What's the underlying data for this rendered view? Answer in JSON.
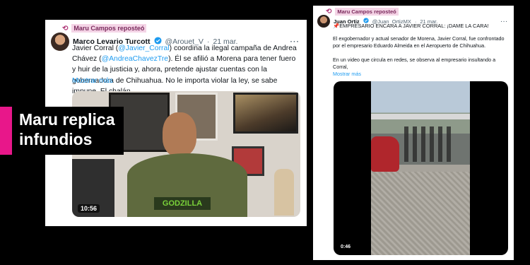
{
  "colors": {
    "accent_magenta": "#e8178a",
    "link_blue": "#1d9bf0",
    "repost_highlight": "#f4d4e6"
  },
  "left_tweet": {
    "repost_label": "Maru Campos reposteó",
    "author_name": "Marco Levario Turcott",
    "handle": "@Arouet_V",
    "date": "21 mar.",
    "text_segments": [
      {
        "text": "Javier Corral (",
        "type": "text"
      },
      {
        "text": "@Javier_Corral",
        "type": "mention"
      },
      {
        "text": ") coordina la ilegal campaña de Andrea Chávez (",
        "type": "text"
      },
      {
        "text": "@AndreaChavezTre",
        "type": "mention"
      },
      {
        "text": "). Él se afilió a Morena para tener fuero y huir de la justicia y, ahora, pretende ajustar cuentas con la gobernadora de Chihuahua. No le importa violar la ley, se sabe impune. El chalán",
        "type": "text"
      }
    ],
    "show_more": "Mostrar más",
    "video_duration": "10:56",
    "shirt_print": "GODZILLA"
  },
  "right_tweet": {
    "repost_label": "Maru Campos reposteó",
    "author_name": "Juan Ortiz",
    "handle": "@Juan_OrtizMX",
    "date": "21 mar.",
    "headline": "📌EMPRESARIO ENCARA A JAVIER CORRAL: ¡DAME LA CARA!",
    "paragraph_1": "El exgobernador y actual senador de Morena, Javier Corral, fue confrontado por el empresario Eduardo Almeida en el Aeropuerto de Chihuahua.",
    "paragraph_2": "En un video que circula en redes, se observa al empresario insultando a Corral,",
    "show_more": "Mostrar más",
    "video_duration": "0:46"
  },
  "caption": {
    "line_1": "Maru replica",
    "line_2": "infundios"
  },
  "icons": {
    "repost": "repost-icon",
    "verified": "verified-badge-icon",
    "more": "more-options-icon",
    "pin": "pushpin-icon"
  }
}
